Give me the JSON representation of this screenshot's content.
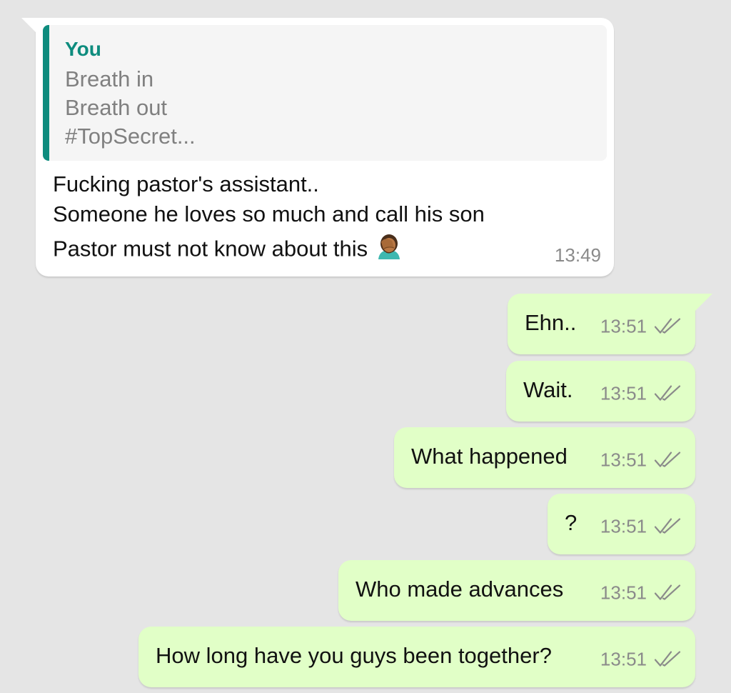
{
  "incoming": {
    "quote": {
      "author": "You",
      "lines": [
        "Breath in",
        "Breath out",
        "#TopSecret..."
      ]
    },
    "lines": [
      "Fucking pastor's assistant..",
      "Someone he loves so much and call his son",
      "Pastor must not know about this"
    ],
    "time": "13:49",
    "emoji": "facepalm-icon"
  },
  "outgoing": [
    {
      "text": "Ehn..",
      "time": "13:51",
      "status": "double-check-icon"
    },
    {
      "text": "Wait.",
      "time": "13:51",
      "status": "double-check-icon"
    },
    {
      "text": "What happened",
      "time": "13:51",
      "status": "double-check-icon"
    },
    {
      "text": "?",
      "time": "13:51",
      "status": "double-check-icon"
    },
    {
      "text": "Who made advances",
      "time": "13:51",
      "status": "double-check-icon"
    },
    {
      "text": "How long have you guys been together?",
      "time": "13:51",
      "status": "double-check-icon"
    }
  ],
  "colors": {
    "background": "#e5e5e5",
    "incoming_bubble": "#ffffff",
    "outgoing_bubble": "#e1ffc7",
    "quote_accent": "#0e8c7e",
    "meta_text": "#8a8a8a"
  }
}
